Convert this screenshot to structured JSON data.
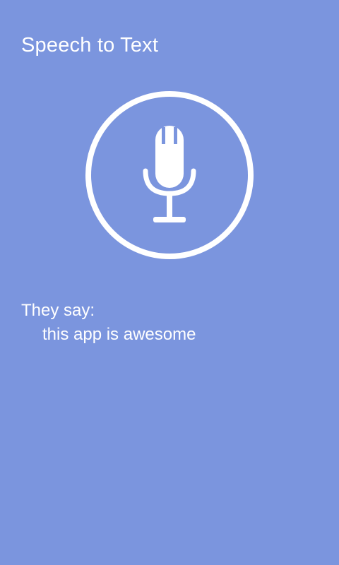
{
  "header": {
    "title": "Speech to Text"
  },
  "mic": {
    "icon": "microphone-icon"
  },
  "result": {
    "label": "They say:",
    "text": "this app is awesome"
  },
  "colors": {
    "background": "#7b95de",
    "foreground": "#ffffff"
  }
}
